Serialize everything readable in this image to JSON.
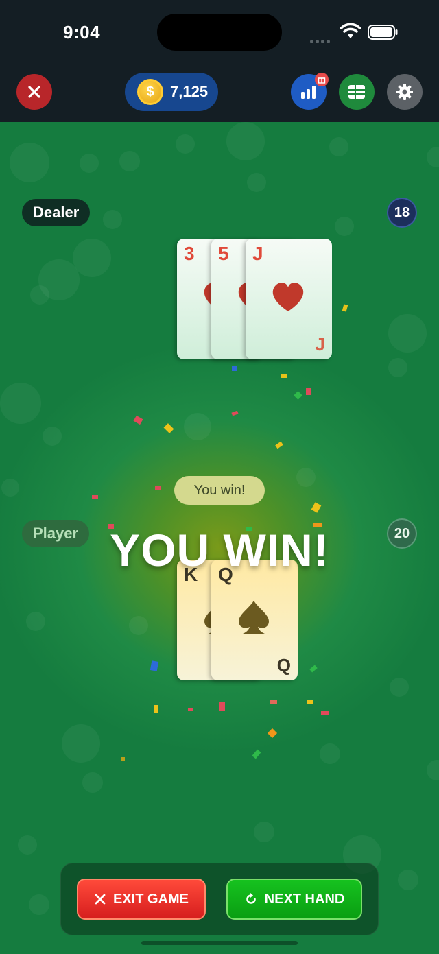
{
  "status_bar": {
    "time": "9:04"
  },
  "header": {
    "coin_amount": "7,125",
    "coin_symbol": "$"
  },
  "dealer": {
    "label": "Dealer",
    "score": "18",
    "cards": [
      {
        "rank": "3",
        "suit": "hearts"
      },
      {
        "rank": "5",
        "suit": "hearts"
      },
      {
        "rank": "J",
        "suit": "hearts"
      }
    ]
  },
  "player": {
    "label": "Player",
    "score": "20",
    "cards": [
      {
        "rank": "K",
        "suit": "spades"
      },
      {
        "rank": "Q",
        "suit": "spades"
      }
    ]
  },
  "result": {
    "toast": "You win!",
    "banner": "YOU WIN!"
  },
  "actions": {
    "exit_label": "EXIT GAME",
    "next_label": "NEXT HAND"
  },
  "colors": {
    "felt": "#1f8a45",
    "exit": "#e52a22",
    "next": "#12b01a",
    "heart": "#c0392b"
  }
}
